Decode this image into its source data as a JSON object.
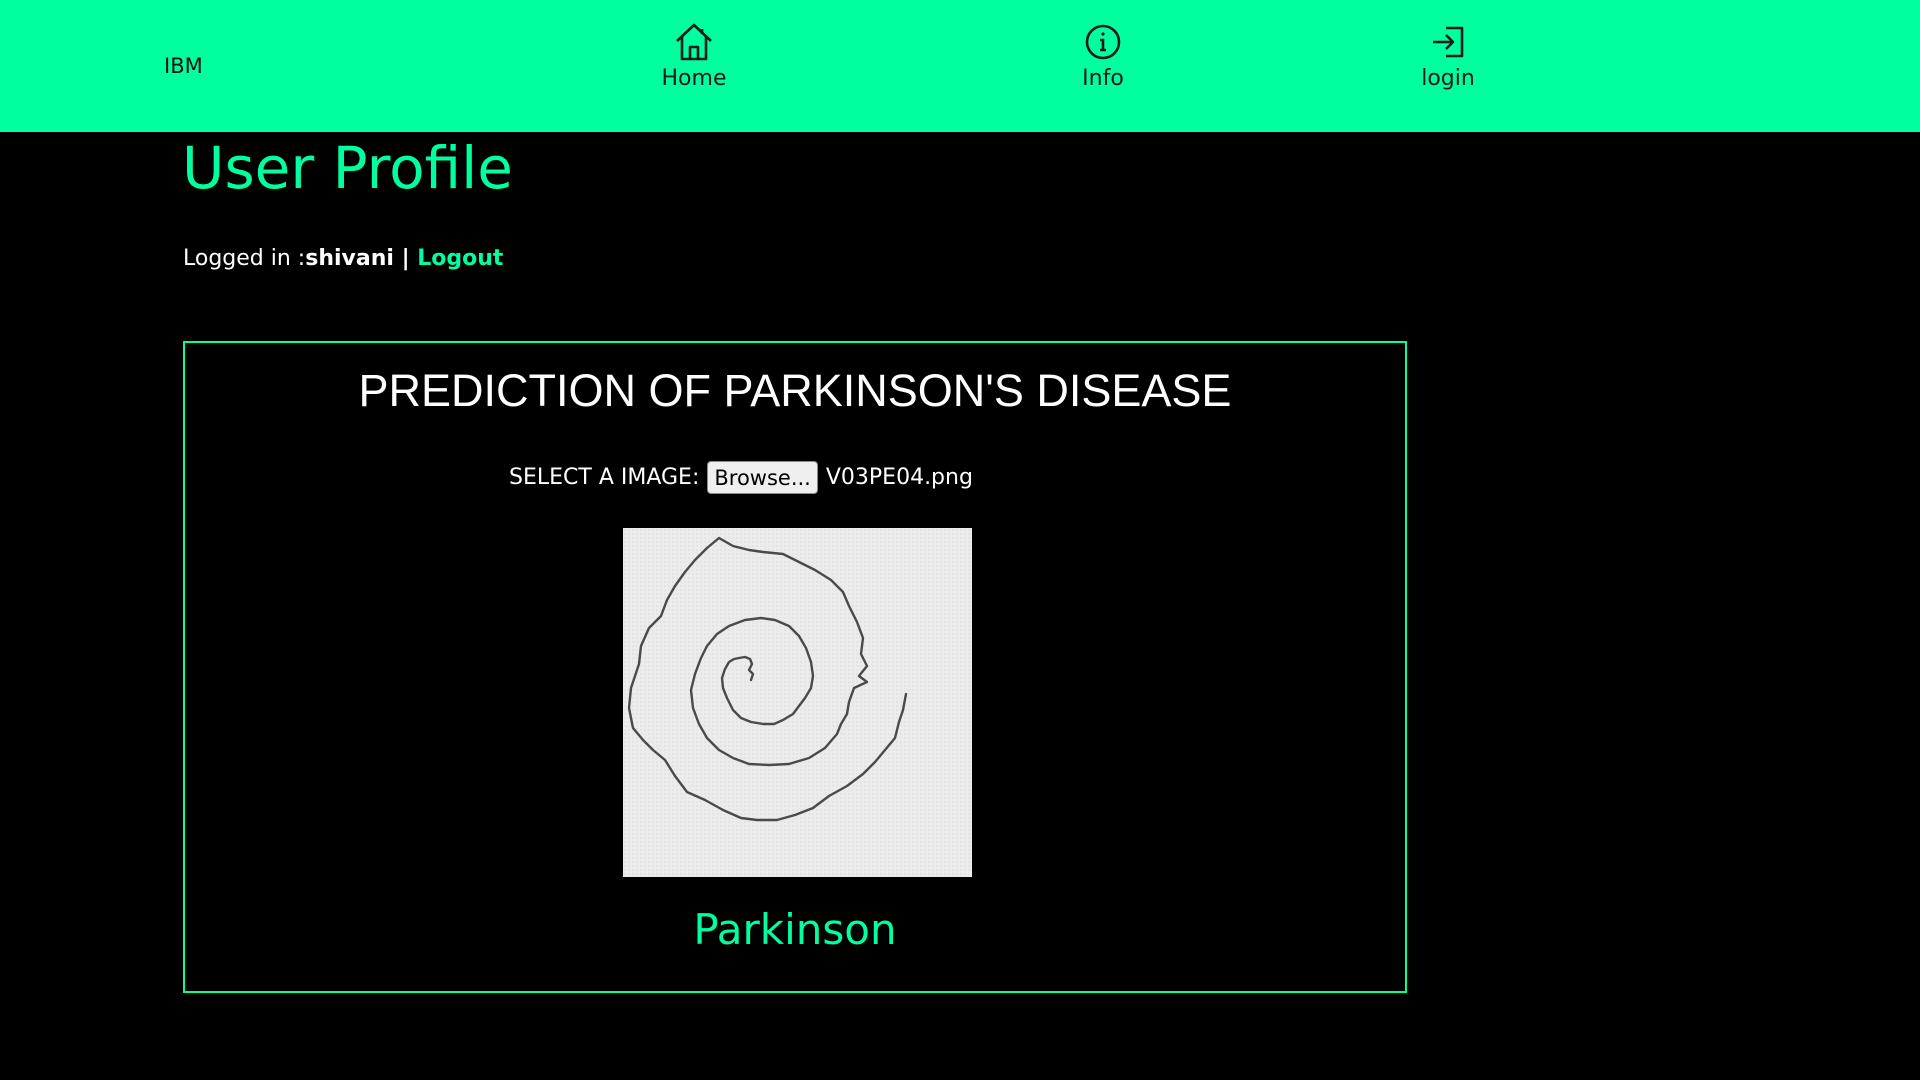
{
  "header": {
    "brand": "IBM",
    "nav": {
      "home_label": "Home",
      "home_icon": "home-icon",
      "info_label": "Info",
      "info_icon": "info-icon",
      "login_label": "login",
      "login_icon": "login-icon"
    },
    "background_color": "#00ff9f"
  },
  "main": {
    "title": "User Profile",
    "logged_in_prefix": "Logged in :",
    "username": "shivani",
    "separator": " | ",
    "logout_label": "Logout",
    "accent_color": "#00ff9f"
  },
  "panel": {
    "heading": "PREDICTION OF PARKINSON'S DISEASE",
    "select_label": "SELECT A IMAGE:",
    "browse_label": "Browse...",
    "file_name": "V03PE04.png",
    "result": "Parkinson"
  }
}
